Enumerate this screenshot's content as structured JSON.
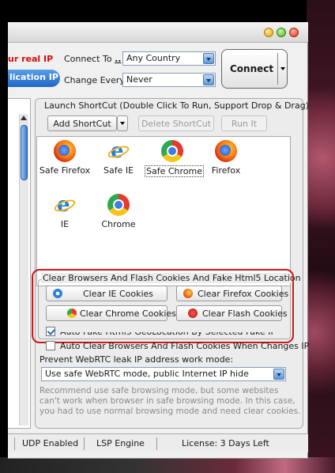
{
  "connect": {
    "real_ip_label": "ur real IP",
    "connect_to_label": "Connect To",
    "connect_to_link": "..",
    "country_value": "Any Country",
    "application_ip_label": "lication IP",
    "change_every_label": "Change Every",
    "change_every_value": "Never",
    "connect_button": "Connect"
  },
  "launch": {
    "group_title": "Launch ShortCut (Double Click To Run, Support Drop & Drag)",
    "add_shortcut": "Add ShortCut",
    "delete_shortcut": "Delete ShortCut",
    "run_it": "Run It",
    "shortcuts": [
      {
        "label": "Safe Firefox",
        "icon": "firefox-icon"
      },
      {
        "label": "Safe IE",
        "icon": "ie-icon"
      },
      {
        "label": "Safe Chrome",
        "icon": "chrome-icon"
      },
      {
        "label": "Firefox",
        "icon": "firefox-icon"
      },
      {
        "label": "IE",
        "icon": "ie-icon"
      },
      {
        "label": "Chrome",
        "icon": "chrome-icon"
      }
    ]
  },
  "clear": {
    "group_title": "Clear Browsers And Flash Cookies And Fake Html5 Location",
    "ie_button": "Clear IE Cookies",
    "firefox_button": "Clear Firefox Cookies",
    "chrome_button": "Clear Chrome Cookies",
    "flash_button": "Clear Flash Cookies"
  },
  "options": {
    "auto_fake_label": "Auto Fake Html5 GeoLocation By Selected Fake IP",
    "auto_clear_label": "Auto Clear Browsers And Flash Cookies When Changes IP",
    "webrtc_label": "Prevent WebRTC leak IP address work mode:",
    "webrtc_value": "Use safe WebRTC mode, public Internet IP hide",
    "note_line1": "Recommend use safe browsing mode, but some websites",
    "note_line2": "can't work when browser in safe browsing mode. In this case,",
    "note_line3": "you had to use normal browsing mode and need clear cookies."
  },
  "status": {
    "udp": "UDP Enabled",
    "engine": "LSP Engine",
    "license": "License: 3 Days Left"
  },
  "colors": {
    "accent_red": "#d01818",
    "accent_blue": "#1f66c4"
  }
}
